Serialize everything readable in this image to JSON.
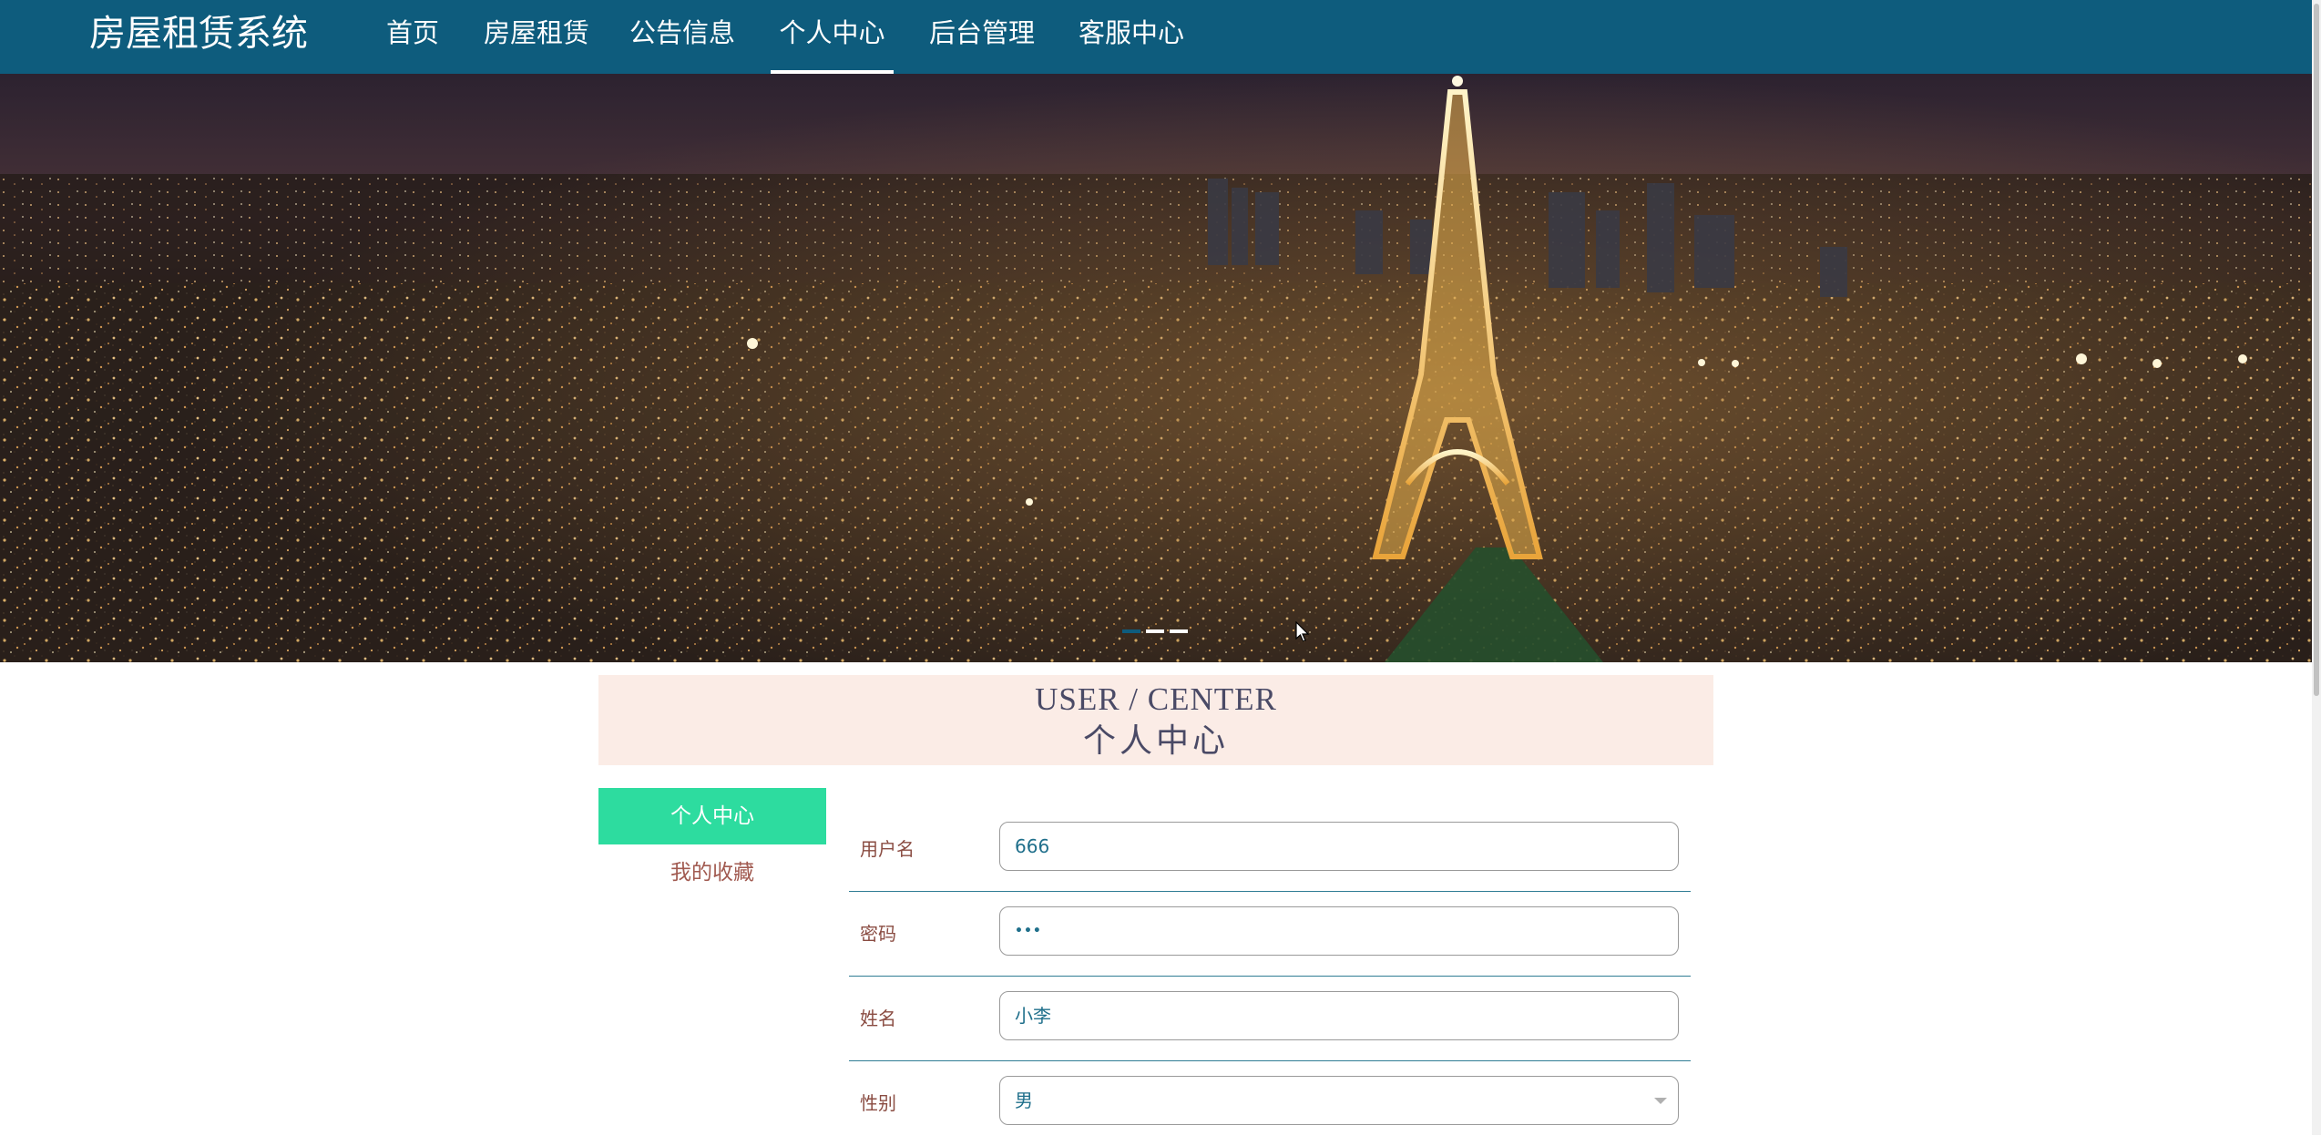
{
  "app": {
    "title": "房屋租赁系统"
  },
  "nav": {
    "items": [
      {
        "label": "首页"
      },
      {
        "label": "房屋租赁"
      },
      {
        "label": "公告信息"
      },
      {
        "label": "个人中心",
        "active": true
      },
      {
        "label": "后台管理"
      },
      {
        "label": "客服中心"
      }
    ]
  },
  "banner": {
    "image": "paris-night-eiffel-tower",
    "slides": 3,
    "active_slide": 1
  },
  "center_header": {
    "en": "USER / CENTER",
    "cn": "个人中心"
  },
  "side_menu": {
    "items": [
      {
        "label": "个人中心",
        "active": true
      },
      {
        "label": "我的收藏"
      }
    ]
  },
  "form": {
    "username": {
      "label": "用户名",
      "value": "666"
    },
    "password": {
      "label": "密码",
      "value": "•••"
    },
    "name": {
      "label": "姓名",
      "value": "小李"
    },
    "gender": {
      "label": "性别",
      "value": "男"
    }
  },
  "colors": {
    "nav_bg": "#0e5c7d",
    "menu_active": "#2ddc9f",
    "header_strip": "#fbece6",
    "label_text": "#8a4c42",
    "input_text": "#1f6f8b"
  },
  "icons": [
    "mouse-cursor-icon",
    "chevron-down-icon"
  ]
}
